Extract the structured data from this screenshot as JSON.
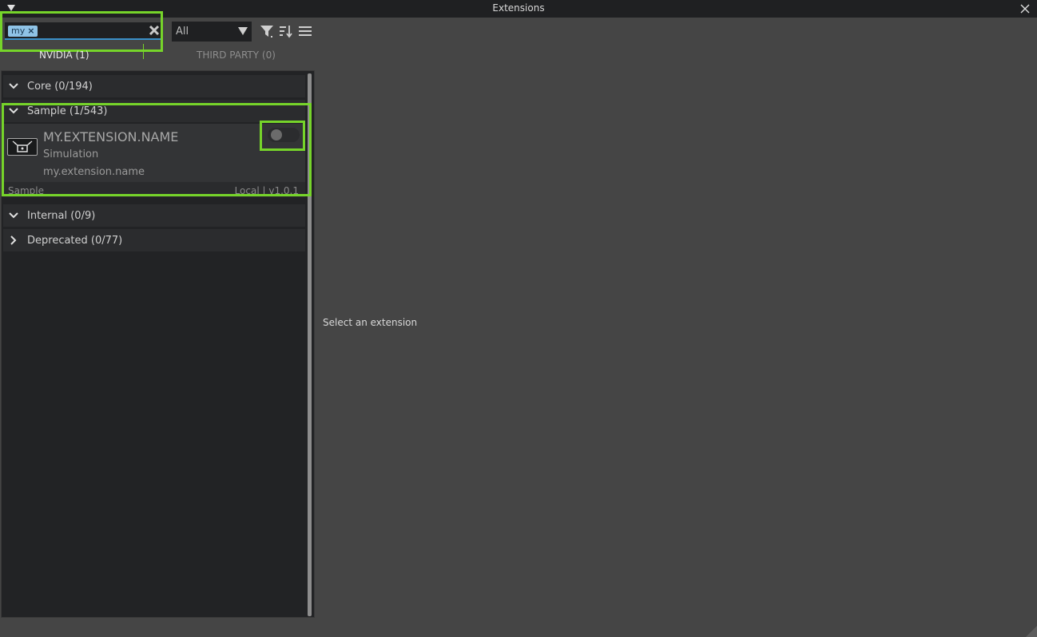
{
  "window": {
    "title": "Extensions"
  },
  "toolbar": {
    "search_tag": "my",
    "filter_value": "All"
  },
  "tabs": [
    {
      "label": "NVIDIA (1)",
      "active": true
    },
    {
      "label": "THIRD PARTY (0)",
      "active": false
    }
  ],
  "groups": [
    {
      "label": "Core (0/194)",
      "expanded": true
    },
    {
      "label": "Sample (1/543)",
      "expanded": true
    },
    {
      "label": "Internal (0/9)",
      "expanded": true
    },
    {
      "label": "Deprecated (0/77)",
      "expanded": false
    }
  ],
  "extension": {
    "name": "MY.EXTENSION.NAME",
    "category": "Simulation",
    "id": "my.extension.name",
    "repo": "Sample",
    "version_info": "Local | v1.0.1",
    "enabled": false
  },
  "detail": {
    "placeholder": "Select an extension"
  },
  "colors": {
    "highlight": "#76d42a",
    "accent": "#3a90c9",
    "panel": "#222325",
    "background": "#454545"
  }
}
